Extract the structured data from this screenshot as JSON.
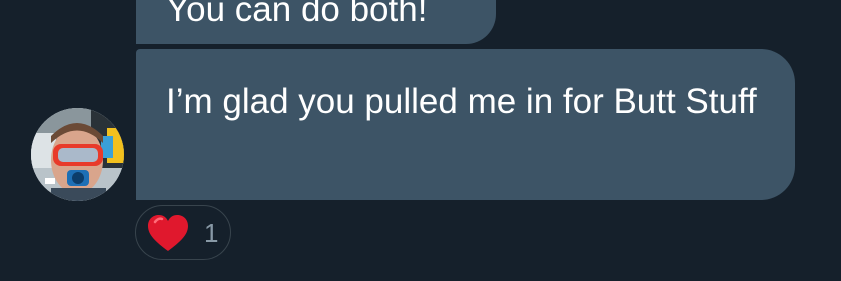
{
  "conversation": {
    "previous_message": {
      "text": "You can do both!"
    },
    "message": {
      "text": "I’m glad you pulled me in for Butt Stuff",
      "reaction": {
        "emoji": "heart-emoji",
        "count": "1"
      }
    }
  },
  "colors": {
    "background": "#15202b",
    "bubble": "#3d5466",
    "text": "#ffffff",
    "reaction_border": "#38444d",
    "reaction_count": "#8899a6",
    "heart": "#e0182d"
  },
  "icons": {
    "avatar": "user-avatar-photo",
    "reaction": "heart-icon"
  }
}
